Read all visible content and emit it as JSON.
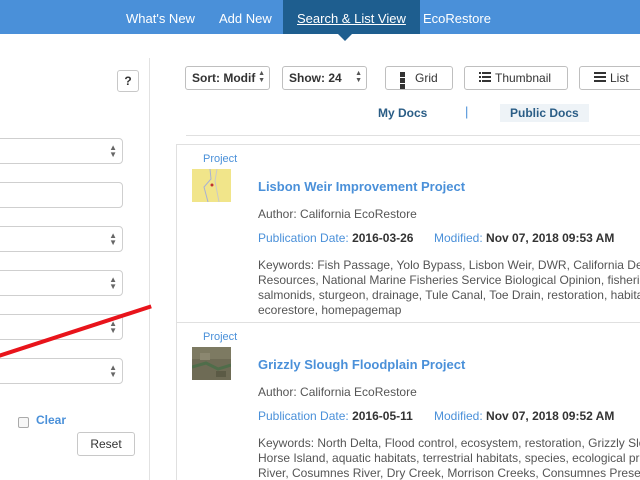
{
  "nav": {
    "tabs": [
      {
        "label": "What's New"
      },
      {
        "label": "Add New"
      },
      {
        "label": "Search & List View"
      },
      {
        "label": "EcoRestore"
      }
    ],
    "active_tab": "Search & List View"
  },
  "filters": {
    "help_label": "?",
    "clear_label": "Clear",
    "reset_label": "Reset"
  },
  "toolbar": {
    "sort_label": "Sort: Modif",
    "show_label": "Show: 24",
    "grid_label": "Grid",
    "thumbnail_label": "Thumbnail",
    "list_label": "List"
  },
  "doc_tabs": {
    "my_docs": "My Docs",
    "separator": "|",
    "public_docs": "Public Docs"
  },
  "results": [
    {
      "type": "Project",
      "title": "Lisbon Weir Improvement Project",
      "author": "Author: California EcoRestore",
      "pub_label": "Publication Date:",
      "pub_date": "2016-03-26",
      "mod_label": "Modified:",
      "mod_date": "Nov 07, 2018 09:53 AM",
      "keywords": [
        "Keywords: Fish Passage, Yolo Bypass, Lisbon Weir, DWR, California Depar",
        "Resources, National Marine Fisheries Service Biological Opinion, fisherie",
        "salmonids, sturgeon, drainage, Tule Canal, Toe Drain, restoration, habita",
        "ecorestore, homepagemap"
      ]
    },
    {
      "type": "Project",
      "title": "Grizzly Slough Floodplain Project",
      "author": "Author: California EcoRestore",
      "pub_label": "Publication Date:",
      "pub_date": "2016-05-11",
      "mod_label": "Modified:",
      "mod_date": "Nov 07, 2018 09:52 AM",
      "keywords": [
        "Keywords: North Delta, Flood control, ecosystem, restoration, Grizzly Slo",
        "Horse Island, aquatic habitats, terrestrial habitats, species, ecological pr",
        "River, Cosumnes River, Dry Creek, Morrison Creeks, Consumnes Preserve",
        "homepagemap"
      ]
    }
  ],
  "colors": {
    "nav_bg": "#4a90d9",
    "nav_active": "#1e5e8f",
    "link": "#4a90d9",
    "annotation_line": "#e8141b"
  },
  "icons": [
    "grid-icon",
    "thumbnail-list-icon",
    "list-icon",
    "sort-updown-icon"
  ]
}
